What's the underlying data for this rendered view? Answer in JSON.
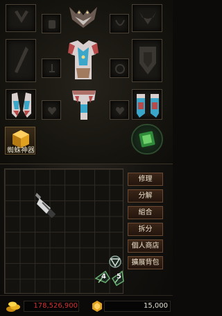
{
  "equipment": {
    "artifact_label": "蜘蛛神器"
  },
  "inventory": {
    "buttons": [
      "修理",
      "分解",
      "組合",
      "拆分",
      "個人商店",
      "擴展背包"
    ],
    "rune_labels": [
      "4",
      "5"
    ]
  },
  "currency": {
    "gold": "178,526,900",
    "coins": "15,000"
  },
  "colors": {
    "gold_text": "#d03232",
    "button_bg": "#3b2618",
    "accent_green": "#2f8a3a"
  }
}
